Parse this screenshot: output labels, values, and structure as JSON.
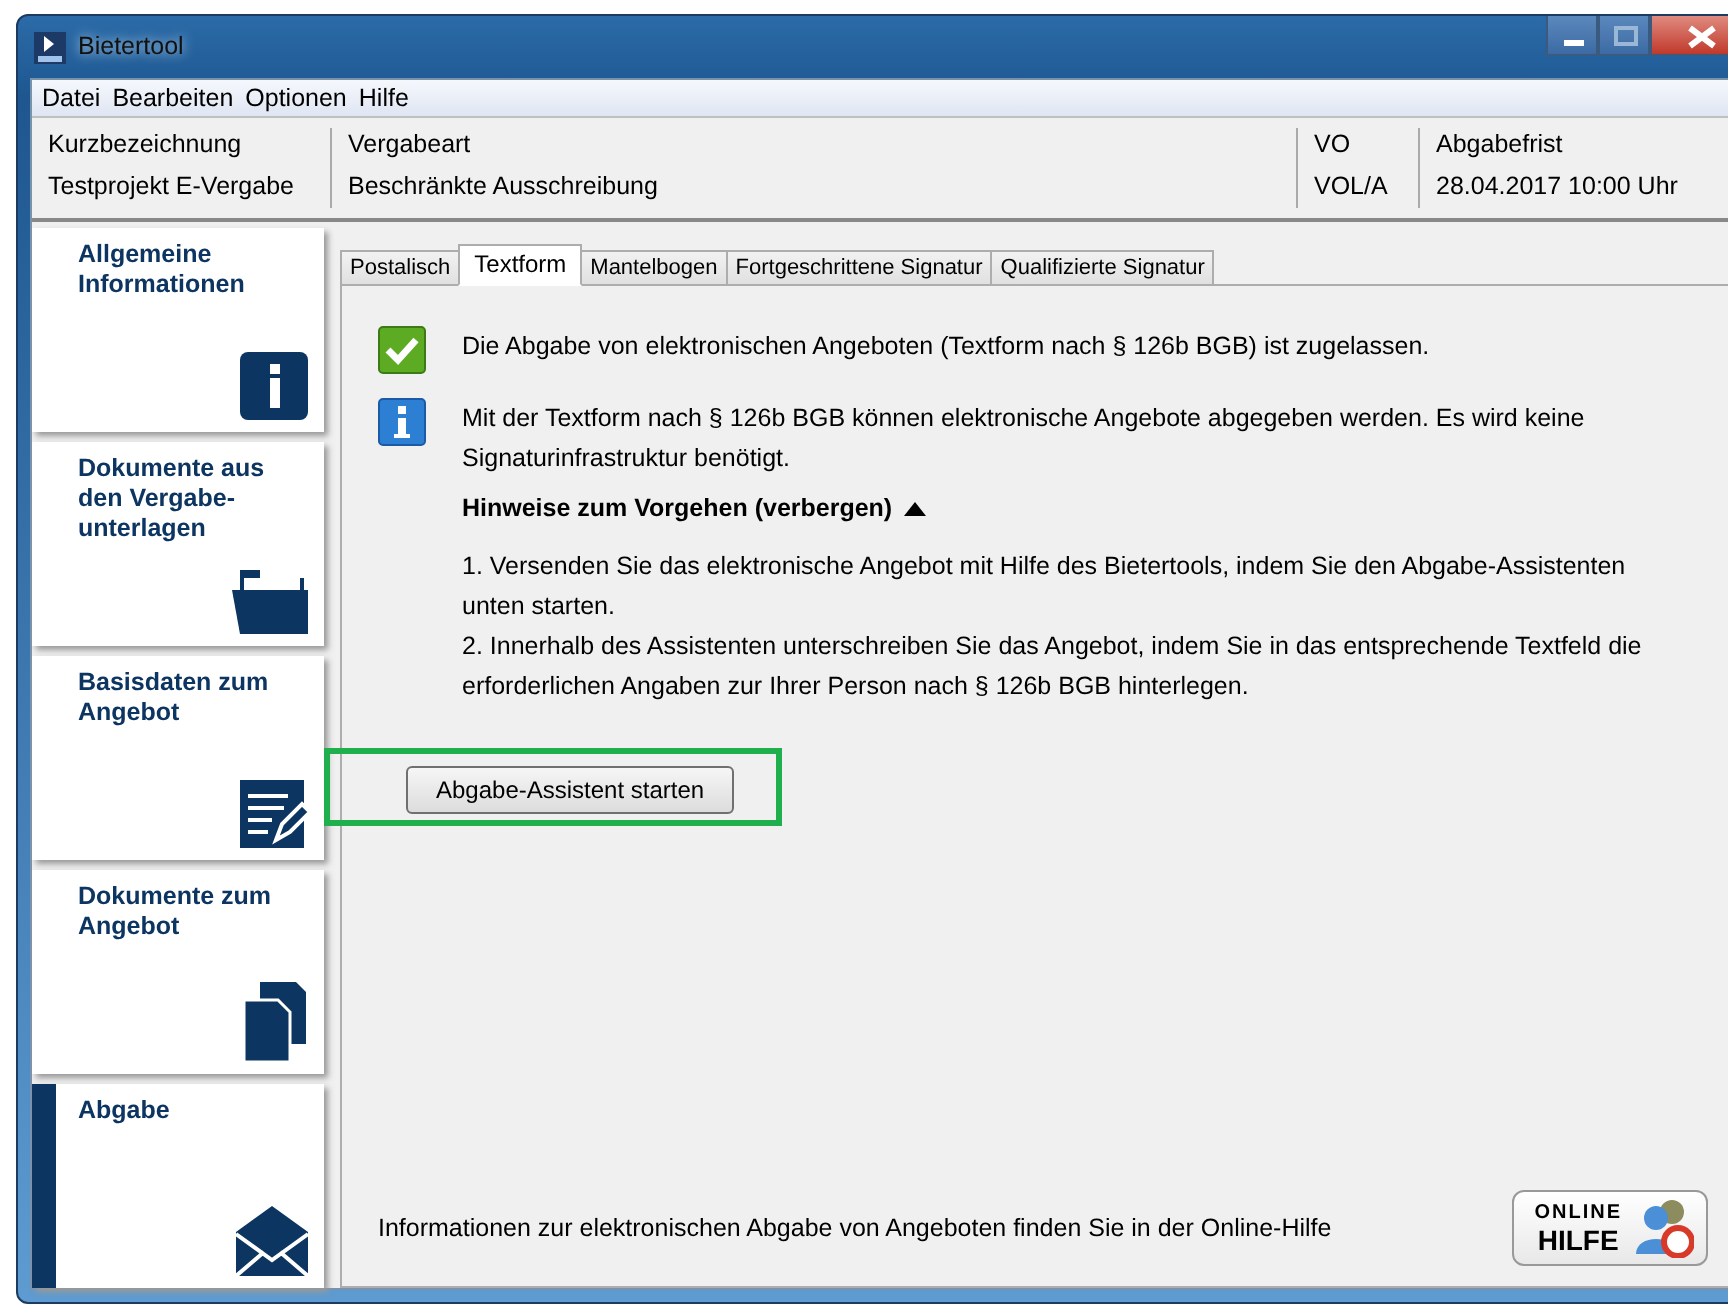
{
  "window": {
    "title": "Bietertool"
  },
  "menu": [
    "Datei",
    "Bearbeiten",
    "Optionen",
    "Hilfe"
  ],
  "header": [
    {
      "label": "Kurzbezeichnung",
      "value": "Testprojekt E-Vergabe"
    },
    {
      "label": "Vergabeart",
      "value": "Beschränkte Ausschreibung"
    },
    {
      "label": "VO",
      "value": "VOL/A"
    },
    {
      "label": "Abgabefrist",
      "value": "28.04.2017 10:00 Uhr"
    }
  ],
  "sidebar": {
    "items": [
      {
        "label": "Allgemeine Informationen",
        "kind": "info",
        "selected": false
      },
      {
        "label": "Dokumente aus den Vergabe-unterlagen",
        "kind": "folder",
        "selected": false
      },
      {
        "label": "Basisdaten zum Angebot",
        "kind": "form",
        "selected": false
      },
      {
        "label": "Dokumente zum Angebot",
        "kind": "documents",
        "selected": false
      },
      {
        "label": "Abgabe",
        "kind": "envelope",
        "selected": true
      }
    ]
  },
  "tabs": [
    {
      "label": "Postalisch",
      "selected": false
    },
    {
      "label": "Textform",
      "selected": true
    },
    {
      "label": "Mantelbogen",
      "selected": false
    },
    {
      "label": "Fortgeschrittene Signatur",
      "selected": false
    },
    {
      "label": "Qualifizierte Signatur",
      "selected": false
    }
  ],
  "messages": [
    {
      "kind": "success",
      "text": "Die Abgabe von elektronischen Angeboten (Textform nach § 126b BGB) ist zugelassen."
    },
    {
      "kind": "info",
      "text": "Mit der Textform nach § 126b BGB können elektronische Angebote abgegeben werden. Es wird keine Signaturinfrastruktur benötigt."
    }
  ],
  "hints": {
    "toggle": "Hinweise zum Vorgehen (verbergen)",
    "expanded": true,
    "steps": [
      "1. Versenden Sie das elektronische Angebot mit Hilfe des Bietertools, indem Sie den Abgabe-Assistenten unten starten.",
      "2. Innerhalb des Assistenten unterschreiben Sie das Angebot, indem Sie in das entsprechende Textfeld die erforderlichen Angaben zur Ihrer Person nach § 126b BGB hinterlegen."
    ]
  },
  "button": "Abgabe-Assistent starten",
  "footer": {
    "text": "Informationen zur elektronischen Abgabe von Angeboten finden Sie in der Online-Hilfe",
    "help_top": "ONLINE",
    "help_bottom": "HILFE"
  }
}
